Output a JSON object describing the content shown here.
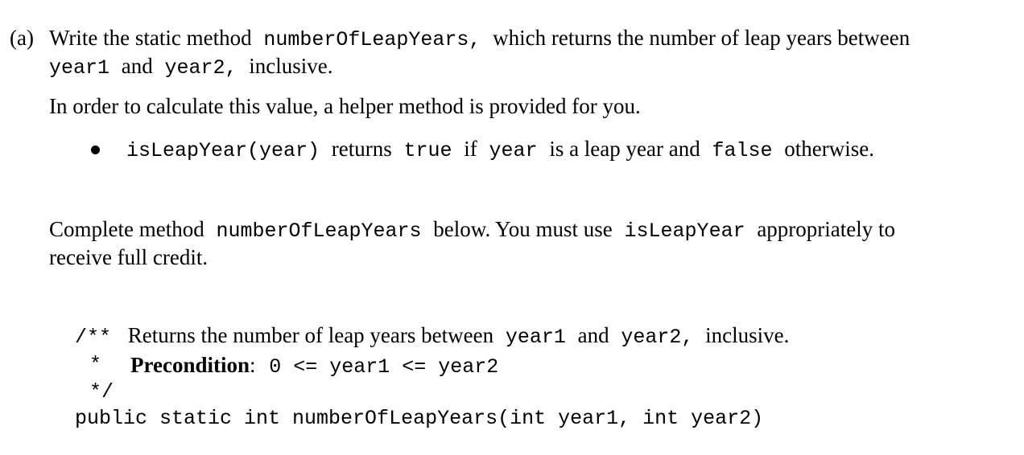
{
  "question": {
    "label": "(a)",
    "line1": {
      "text_a": "Write the static method",
      "code_a": "numberOfLeapYears,",
      "text_b": "which returns the number of leap years between"
    },
    "line2": {
      "code_a": "year1",
      "text_a": "and",
      "code_b": "year2,",
      "text_b": "inclusive."
    },
    "helper_intro": "In order to calculate this value, a helper method is provided for you.",
    "bullet": {
      "code_a": "isLeapYear(year)",
      "text_a": "returns",
      "code_b": "true",
      "text_b": "if",
      "code_c": "year",
      "text_c": "is a leap year and",
      "code_d": "false",
      "text_d": "otherwise."
    },
    "complete": {
      "text_a": "Complete method",
      "code_a": "numberOfLeapYears",
      "text_b": "below. You must use",
      "code_b": "isLeapYear",
      "text_c": "appropriately to",
      "line2": "receive full credit."
    }
  },
  "code_block": {
    "comment_open": "/**",
    "comment_text_a": "Returns the number of leap years between",
    "comment_code_a": "year1",
    "comment_text_b": "and",
    "comment_code_b": "year2,",
    "comment_text_c": "inclusive.",
    "star": "*",
    "precondition_label": "Precondition",
    "precondition_colon": ":",
    "precondition_code": "0 <= year1 <= year2",
    "comment_close": "*/",
    "signature": "public static int numberOfLeapYears(int year1, int year2)"
  }
}
